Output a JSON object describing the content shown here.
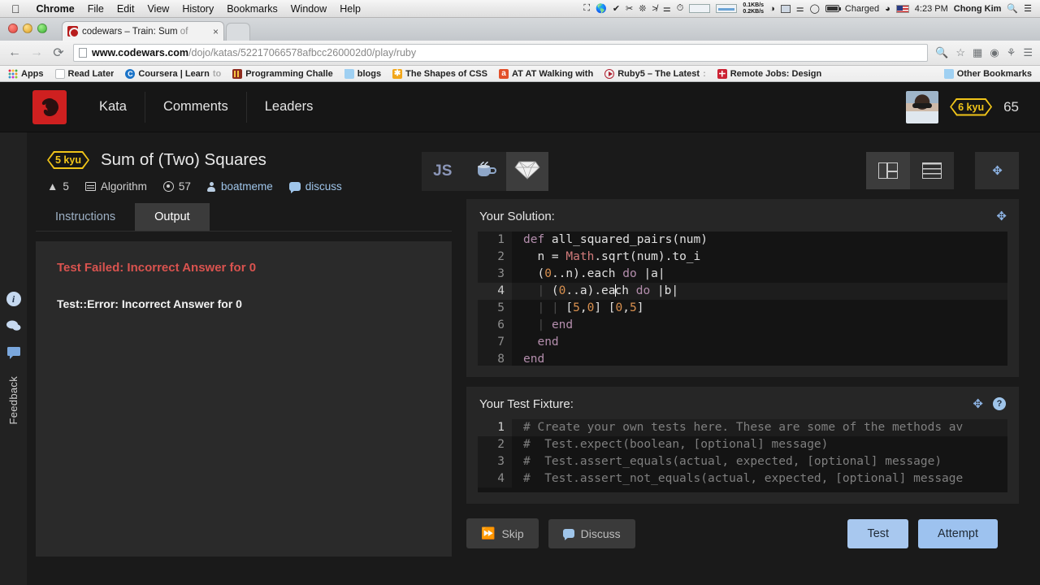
{
  "macbar": {
    "apple": "",
    "menus": [
      "Chrome",
      "File",
      "Edit",
      "View",
      "History",
      "Bookmarks",
      "Window",
      "Help"
    ],
    "net_up": "0.1KB/s",
    "net_down": "0.2KB/s",
    "battery_status": "Charged",
    "time": "4:23 PM",
    "user": "Chong Kim",
    "search_icon": "search-icon",
    "list_icon": "notification-center-icon"
  },
  "browser": {
    "tab_title_strong": "codewars – Train: Sum",
    "tab_title_dim": " of",
    "tab_close": "×",
    "back_icon": "←",
    "forward_icon": "→",
    "reload_icon": "⟳",
    "url_domain": "www.codewars.com",
    "url_path": "/dojo/katas/52217066578afbcc260002d0/play/ruby",
    "omni_icons": [
      "zoom-out-icon",
      "star-icon",
      "extension-icon",
      "sync-icon",
      "key-icon",
      "menu-icon"
    ],
    "bookmarks": [
      {
        "label": "Apps",
        "icon": "apps-grid-icon"
      },
      {
        "label": "Read Later",
        "icon": "blank-page-icon"
      },
      {
        "label": "Coursera | Learn",
        "dim": " to",
        "icon": "coursera-icon"
      },
      {
        "label": "Programming Challe",
        "icon": "programming-icon"
      },
      {
        "label": "blogs",
        "icon": "folder-icon"
      },
      {
        "label": "The Shapes of CSS",
        "icon": "css-icon"
      },
      {
        "label": "AT AT Walking with",
        "icon": "amazon-icon"
      },
      {
        "label": "Ruby5 – The Latest",
        "dim": " :",
        "icon": "ruby5-icon"
      },
      {
        "label": "Remote Jobs: Design",
        "icon": "remote-jobs-icon"
      }
    ],
    "other_bookmarks": "Other Bookmarks"
  },
  "site_header": {
    "logo": "codewars-logo",
    "nav": [
      "Kata",
      "Comments",
      "Leaders"
    ],
    "avatar": "user-avatar",
    "rank": "6 kyu",
    "honor": "65"
  },
  "rail": {
    "icons": [
      "info-icon",
      "comments-icon",
      "feedback-icon"
    ],
    "label": "Feedback"
  },
  "kata": {
    "rank": "5 kyu",
    "title": "Sum of (Two) Squares",
    "votes": "5",
    "votes_icon": "upvote-icon",
    "category": "Algorithm",
    "category_icon": "category-icon",
    "completed": "57",
    "completed_icon": "target-icon",
    "author": "boatmeme",
    "author_icon": "person-icon",
    "discuss": "discuss",
    "discuss_icon": "comment-bubble-icon"
  },
  "languages": [
    {
      "name": "JS",
      "icon": "javascript-icon",
      "active": false
    },
    {
      "name": "Java",
      "icon": "java-coffee-icon",
      "active": false
    },
    {
      "name": "Ruby",
      "icon": "ruby-gem-icon",
      "active": true
    }
  ],
  "layout_buttons": [
    {
      "name": "split-layout-icon",
      "active": true
    },
    {
      "name": "stacked-layout-icon",
      "active": false
    },
    {
      "name": "fullscreen-icon",
      "active": false
    }
  ],
  "left_panel": {
    "tabs": [
      {
        "label": "Instructions",
        "active": false
      },
      {
        "label": "Output",
        "active": true
      }
    ],
    "fail_heading": "Test Failed: Incorrect Answer for 0",
    "error_line": "Test::Error: Incorrect Answer for 0"
  },
  "solution": {
    "title": "Your Solution:",
    "expand_icon": "expand-icon",
    "lines": [
      {
        "n": "1",
        "text": "def all_squared_pairs(num)"
      },
      {
        "n": "2",
        "text": "  n = Math.sqrt(num).to_i"
      },
      {
        "n": "3",
        "text": "  (0..n).each do |a|"
      },
      {
        "n": "4",
        "text": "    (0..a).each do |b|",
        "current": true
      },
      {
        "n": "5",
        "text": "      [5,0] [0,5]"
      },
      {
        "n": "6",
        "text": "    end"
      },
      {
        "n": "7",
        "text": "  end"
      },
      {
        "n": "8",
        "text": "end"
      }
    ]
  },
  "fixture": {
    "title": "Your Test Fixture:",
    "expand_icon": "expand-icon",
    "help_icon": "help-icon",
    "lines": [
      {
        "n": "1",
        "text": "# Create your own tests here. These are some of the methods av"
      },
      {
        "n": "2",
        "text": "#  Test.expect(boolean, [optional] message)"
      },
      {
        "n": "3",
        "text": "#  Test.assert_equals(actual, expected, [optional] message)"
      },
      {
        "n": "4",
        "text": "#  Test.assert_not_equals(actual, expected, [optional] message"
      }
    ]
  },
  "footer": {
    "skip": "Skip",
    "skip_icon": "fast-forward-icon",
    "discuss": "Discuss",
    "discuss_icon": "comment-bubble-icon",
    "test": "Test",
    "attempt": "Attempt"
  },
  "colors": {
    "brand_red": "#cf2020",
    "rank_yellow": "#f0c419",
    "fail_red": "#d9534f",
    "primary_button": "#a8c8ef",
    "link_blue": "#9fc5ea"
  }
}
